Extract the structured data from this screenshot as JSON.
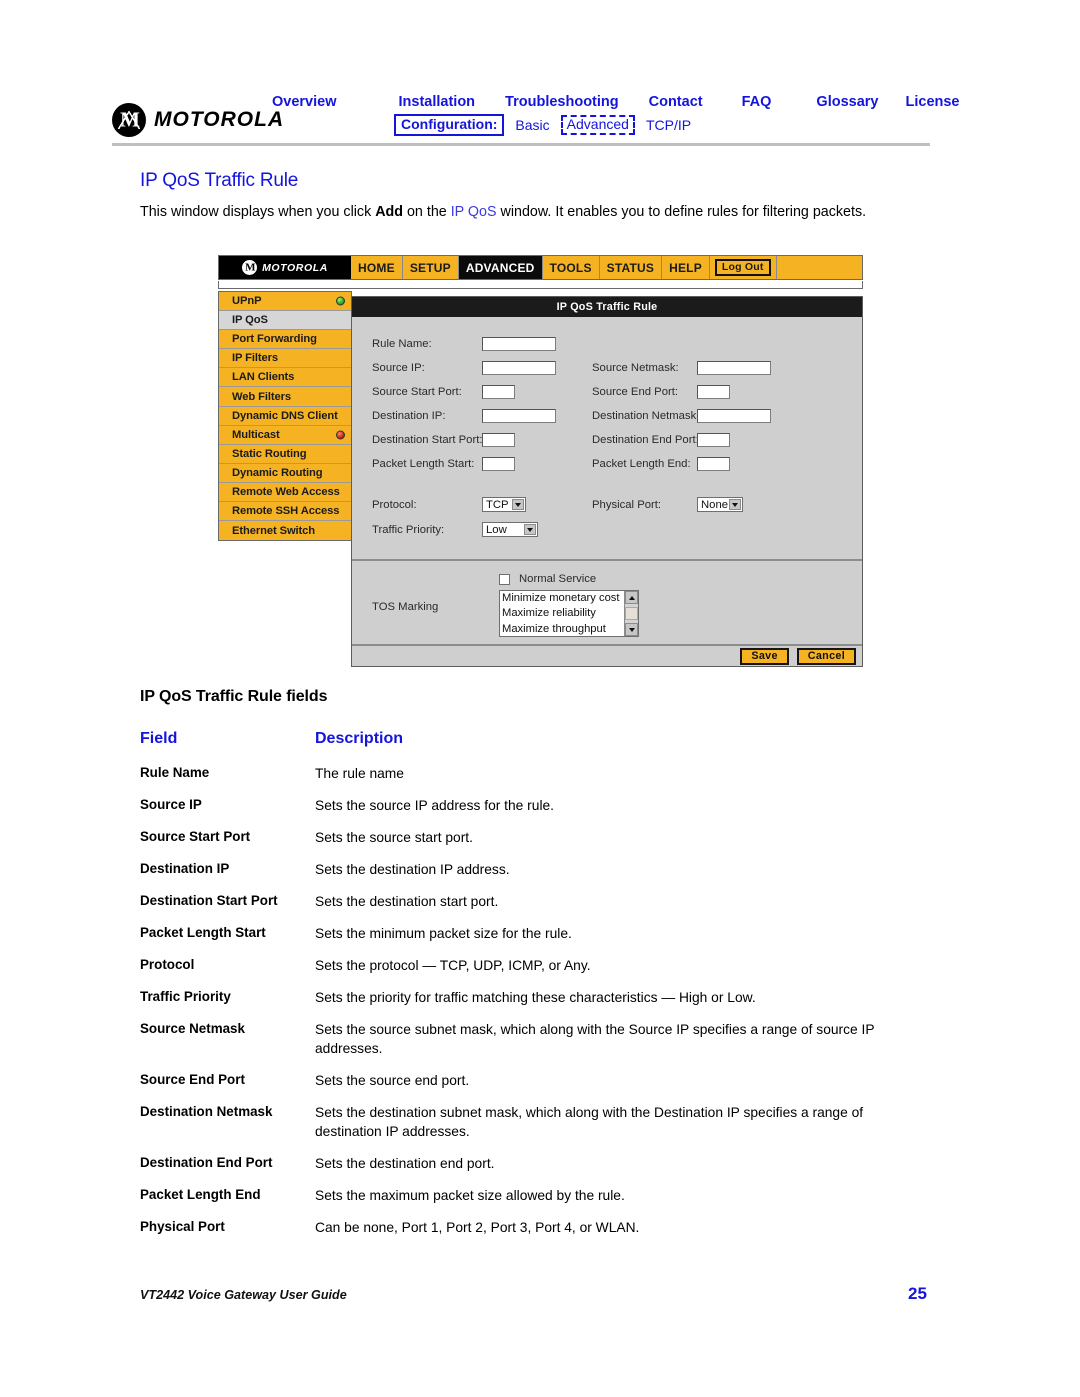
{
  "doc_header": {
    "brand": "MOTOROLA",
    "nav_primary": [
      "Overview",
      "Installation",
      "Troubleshooting",
      "Contact",
      "FAQ",
      "Glossary",
      "License"
    ],
    "nav_secondary": {
      "configuration_label": "Configuration:",
      "items": [
        "Basic",
        "Advanced",
        "TCP/IP"
      ],
      "selected": "Advanced"
    }
  },
  "page": {
    "title": "IP QoS Traffic Rule",
    "intro_part1": "This window displays when you click ",
    "intro_bold": "Add",
    "intro_part2": " on the ",
    "intro_link": "IP QoS",
    "intro_part3": " window. It enables you to define rules for filtering packets."
  },
  "screenshot": {
    "brand": "MOTOROLA",
    "topmenu": [
      "HOME",
      "SETUP",
      "ADVANCED",
      "TOOLS",
      "STATUS",
      "HELP"
    ],
    "active_menu": "ADVANCED",
    "logout_label": "Log Out",
    "sidebar": [
      {
        "label": "UPnP",
        "led": "green",
        "selected": false
      },
      {
        "label": "IP QoS",
        "led": "",
        "selected": true
      },
      {
        "label": "Port Forwarding",
        "led": "",
        "selected": false
      },
      {
        "label": "IP Filters",
        "led": "",
        "selected": false
      },
      {
        "label": "LAN Clients",
        "led": "",
        "selected": false
      },
      {
        "label": "Web Filters",
        "led": "",
        "selected": false
      },
      {
        "label": "Dynamic DNS Client",
        "led": "",
        "selected": false
      },
      {
        "label": "Multicast",
        "led": "red",
        "selected": false
      },
      {
        "label": "Static Routing",
        "led": "",
        "selected": false
      },
      {
        "label": "Dynamic Routing",
        "led": "",
        "selected": false
      },
      {
        "label": "Remote Web Access",
        "led": "",
        "selected": false
      },
      {
        "label": "Remote SSH Access",
        "led": "",
        "selected": false
      },
      {
        "label": "Ethernet Switch",
        "led": "",
        "selected": false
      }
    ],
    "panel_title": "IP QoS Traffic Rule",
    "left_fields": [
      {
        "label": "Rule Name:",
        "value": ""
      },
      {
        "label": "Source IP:",
        "value": ""
      },
      {
        "label": "Source Start Port:",
        "value": ""
      },
      {
        "label": "Destination IP:",
        "value": ""
      },
      {
        "label": "Destination Start Port:",
        "value": ""
      },
      {
        "label": "Packet Length Start:",
        "value": ""
      }
    ],
    "right_fields": [
      {
        "label": "Source Netmask:",
        "value": ""
      },
      {
        "label": "Source End Port:",
        "value": ""
      },
      {
        "label": "Destination Netmask:",
        "value": ""
      },
      {
        "label": "Destination End Port:",
        "value": ""
      },
      {
        "label": "Packet Length End:",
        "value": ""
      }
    ],
    "protocol": {
      "label": "Protocol:",
      "value": "TCP"
    },
    "traffic_priority": {
      "label": "Traffic Priority:",
      "value": "Low"
    },
    "physical_port": {
      "label": "Physical Port:",
      "value": "None"
    },
    "tos": {
      "label": "TOS Marking",
      "checkbox_label": "Normal Service",
      "checked": false,
      "options": [
        "Minimize monetary cost",
        "Maximize reliability",
        "Maximize throughput"
      ]
    },
    "save_label": "Save",
    "cancel_label": "Cancel"
  },
  "fields_table": {
    "title": "IP QoS Traffic Rule fields",
    "header": {
      "field": "Field",
      "description": "Description"
    },
    "rows": [
      {
        "field": "Rule Name",
        "description": "The rule name"
      },
      {
        "field": "Source IP",
        "description": "Sets the source IP address for the rule."
      },
      {
        "field": "Source Start Port",
        "description": "Sets the source start port."
      },
      {
        "field": "Destination IP",
        "description": "Sets the destination IP address."
      },
      {
        "field": "Destination Start Port",
        "description": "Sets the destination start port."
      },
      {
        "field": "Packet Length Start",
        "description": "Sets the minimum packet size for the rule."
      },
      {
        "field": "Protocol",
        "description": "Sets the protocol — TCP, UDP, ICMP, or Any."
      },
      {
        "field": "Traffic Priority",
        "description": "Sets the priority for traffic matching these characteristics — High or Low."
      },
      {
        "field": "Source Netmask",
        "description": "Sets the source subnet mask, which along with the Source IP specifies a range of source IP addresses."
      },
      {
        "field": "Source End Port",
        "description": "Sets the source end port."
      },
      {
        "field": "Destination Netmask",
        "description": "Sets the destination subnet mask, which along with the Destination IP specifies a range of destination IP addresses."
      },
      {
        "field": "Destination End Port",
        "description": "Sets the destination end port."
      },
      {
        "field": "Packet Length End",
        "description": "Sets the maximum packet size allowed by the rule."
      },
      {
        "field": "Physical Port",
        "description": "Can be none, Port 1, Port 2, Port 3, Port 4, or WLAN."
      }
    ]
  },
  "footer": {
    "document_title": "VT2442 Voice Gateway User Guide",
    "page_number": "25"
  },
  "colors": {
    "link_blue": "#1414dd",
    "router_yellow": "#f5b324",
    "panel_gray": "#cfcfcf",
    "dark_bar": "#1b1b1b"
  }
}
